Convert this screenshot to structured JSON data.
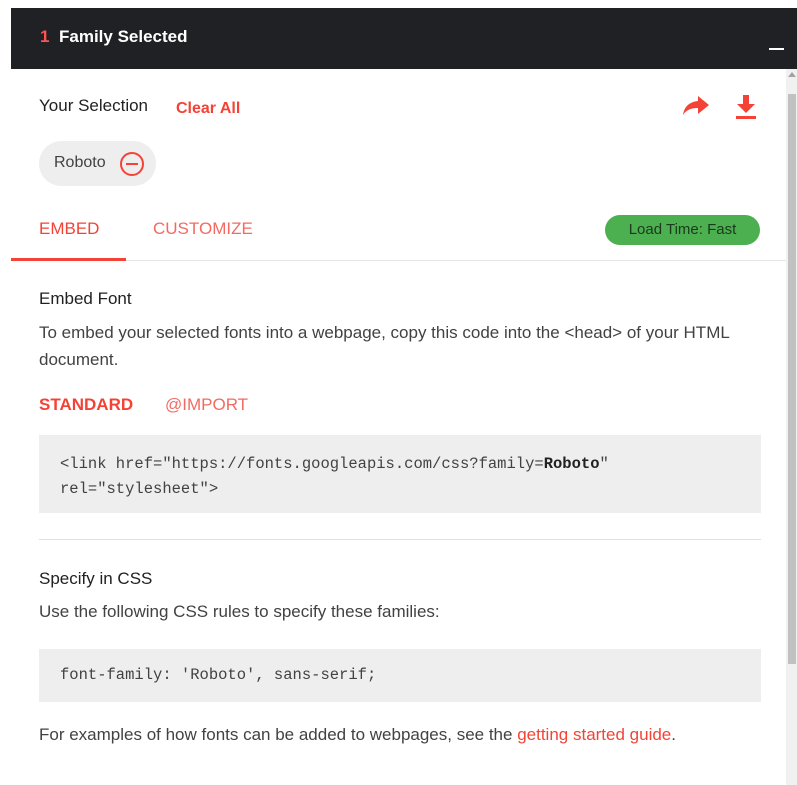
{
  "header": {
    "count": "1",
    "title": "Family Selected",
    "minimize_icon": "minimize-icon"
  },
  "selection": {
    "label": "Your Selection",
    "clear_all": "Clear All",
    "share_icon": "share-icon",
    "download_icon": "download-icon",
    "chips": [
      {
        "label": "Roboto",
        "remove_icon": "remove-circle-icon"
      }
    ]
  },
  "tabs": {
    "embed": "EMBED",
    "customize": "CUSTOMIZE",
    "active": "EMBED"
  },
  "load_time": "Load Time: Fast",
  "embed_section": {
    "heading": "Embed Font",
    "description": "To embed your selected fonts into a webpage, copy this code into the <head> of your HTML document.",
    "subtabs": {
      "standard": "STANDARD",
      "import": "@IMPORT",
      "active": "STANDARD"
    },
    "code_prefix": "<link href=\"https://fonts.googleapis.com/css?family=",
    "code_family": "Roboto",
    "code_suffix": "\" rel=\"stylesheet\">"
  },
  "css_section": {
    "heading": "Specify in CSS",
    "description": "Use the following CSS rules to specify these families:",
    "code": "font-family: 'Roboto', sans-serif;"
  },
  "footer": {
    "text": "For examples of how fonts can be added to webpages, see the ",
    "link": "getting started guide",
    "end": "."
  },
  "colors": {
    "accent": "#f44336",
    "header_bg": "#202124",
    "badge_bg": "#4caf50"
  }
}
